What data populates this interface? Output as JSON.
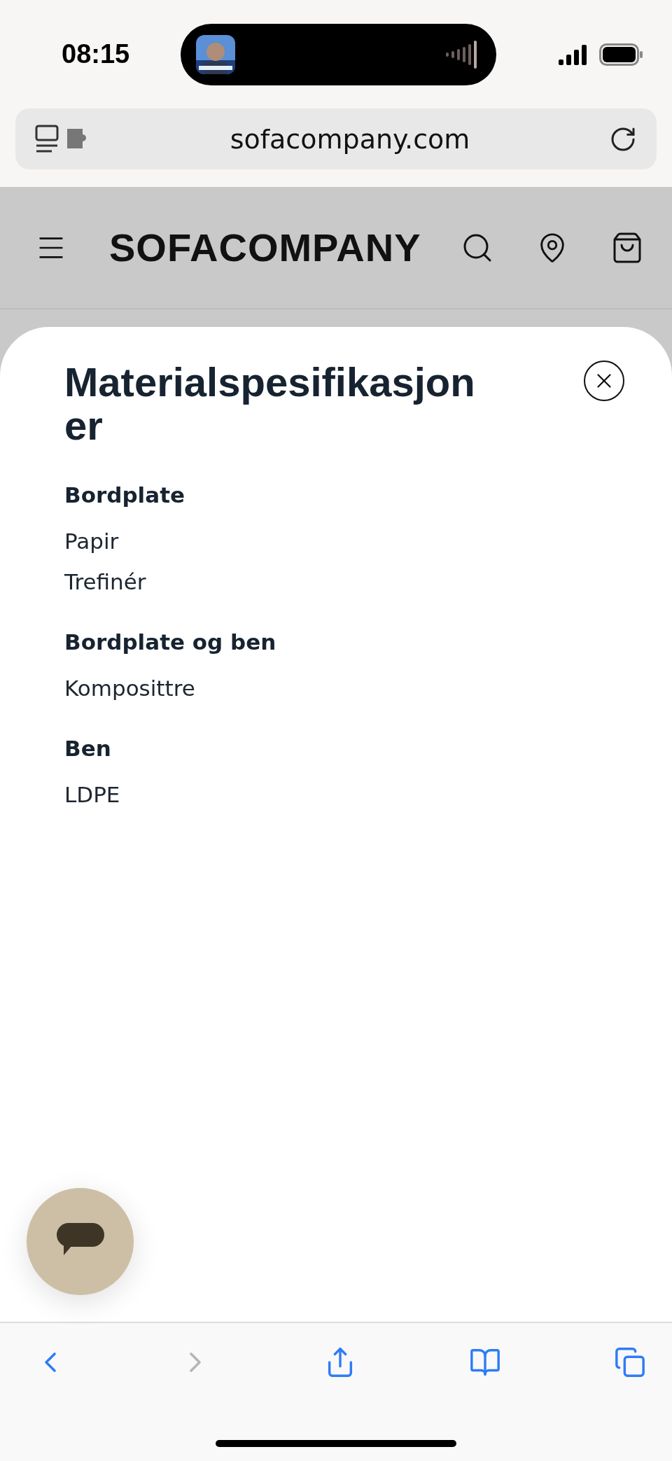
{
  "status_bar": {
    "time": "08:15"
  },
  "address_bar": {
    "url": "sofacompany.com"
  },
  "site_header": {
    "logo": "SOFACOMPANY"
  },
  "sheet": {
    "title": "Materialspesifikasjoner",
    "sections": [
      {
        "heading": "Bordplate",
        "items": [
          "Papir",
          "Trefinér"
        ]
      },
      {
        "heading": "Bordplate og ben",
        "items": [
          "Komposittre"
        ]
      },
      {
        "heading": "Ben",
        "items": [
          "LDPE"
        ]
      }
    ]
  },
  "toolbar": [
    {
      "kind": "back",
      "disabled": false
    },
    {
      "kind": "forward",
      "disabled": true
    },
    {
      "kind": "share",
      "disabled": false
    },
    {
      "kind": "bookmarks",
      "disabled": false
    },
    {
      "kind": "tabs",
      "disabled": false
    }
  ]
}
